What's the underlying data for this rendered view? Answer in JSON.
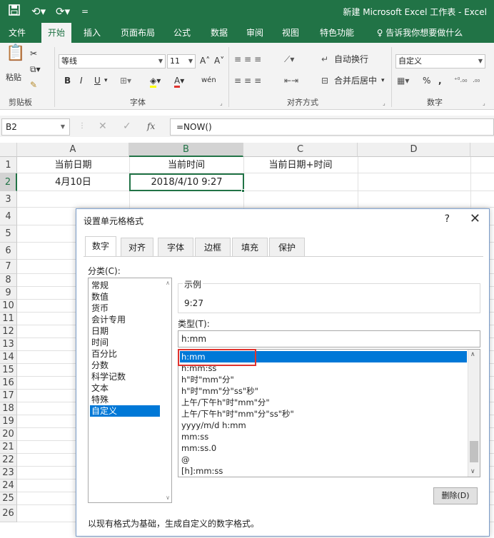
{
  "titlebar": {
    "save_icon": "save-icon",
    "undo_icon": "undo-icon",
    "redo_icon": "redo-icon",
    "title": "新建 Microsoft Excel 工作表  -  Excel"
  },
  "tabs": [
    "文件",
    "开始",
    "插入",
    "页面布局",
    "公式",
    "数据",
    "审阅",
    "视图",
    "特色功能",
    "告诉我你想要做什么"
  ],
  "ribbon": {
    "clipboard": {
      "paste": "粘贴",
      "label": "剪贴板"
    },
    "font": {
      "name": "等线",
      "size": "11",
      "bold": "B",
      "italic": "I",
      "underline": "U",
      "label": "字体",
      "grow": "A˄",
      "shrink": "A˅",
      "phonetic": "wén"
    },
    "alignment": {
      "wrap": "自动换行",
      "merge": "合并后居中",
      "label": "对齐方式"
    },
    "number": {
      "format": "自定义",
      "percent": "%",
      "comma": ",",
      "label": "数字"
    }
  },
  "formula_bar": {
    "name_box": "B2",
    "fx": "fx",
    "formula": "=NOW()"
  },
  "grid": {
    "columns": [
      "A",
      "B",
      "C",
      "D"
    ],
    "rows": [
      "1",
      "2",
      "3",
      "4",
      "5",
      "6",
      "7",
      "8",
      "9",
      "10",
      "11",
      "12",
      "13",
      "14",
      "15",
      "16",
      "17",
      "18",
      "19",
      "20",
      "21",
      "22",
      "23",
      "24",
      "25",
      "26"
    ],
    "A1": "当前日期",
    "B1": "当前时间",
    "C1": "当前日期+时间",
    "A2": "4月10日",
    "B2": "2018/4/10 9:27"
  },
  "dialog": {
    "title": "设置单元格格式",
    "help": "?",
    "close": "✕",
    "tabs": [
      "数字",
      "对齐",
      "字体",
      "边框",
      "填充",
      "保护"
    ],
    "category_label": "分类(C):",
    "categories": [
      "常规",
      "数值",
      "货币",
      "会计专用",
      "日期",
      "时间",
      "百分比",
      "分数",
      "科学记数",
      "文本",
      "特殊",
      "自定义"
    ],
    "sample_label": "示例",
    "sample_value": "9:27",
    "type_label": "类型(T):",
    "type_value": "h:mm",
    "types": [
      "h:mm",
      "h:mm:ss",
      "h\"时\"mm\"分\"",
      "h\"时\"mm\"分\"ss\"秒\"",
      "上午/下午h\"时\"mm\"分\"",
      "上午/下午h\"时\"mm\"分\"ss\"秒\"",
      "yyyy/m/d h:mm",
      "mm:ss",
      "mm:ss.0",
      "@",
      "[h]:mm:ss"
    ],
    "delete_button": "删除(D)",
    "footer": "以现有格式为基础，生成自定义的数字格式。"
  },
  "colors": {
    "excel_green": "#217346",
    "selection_blue": "#0078d7",
    "highlight_red": "#e0332e"
  }
}
